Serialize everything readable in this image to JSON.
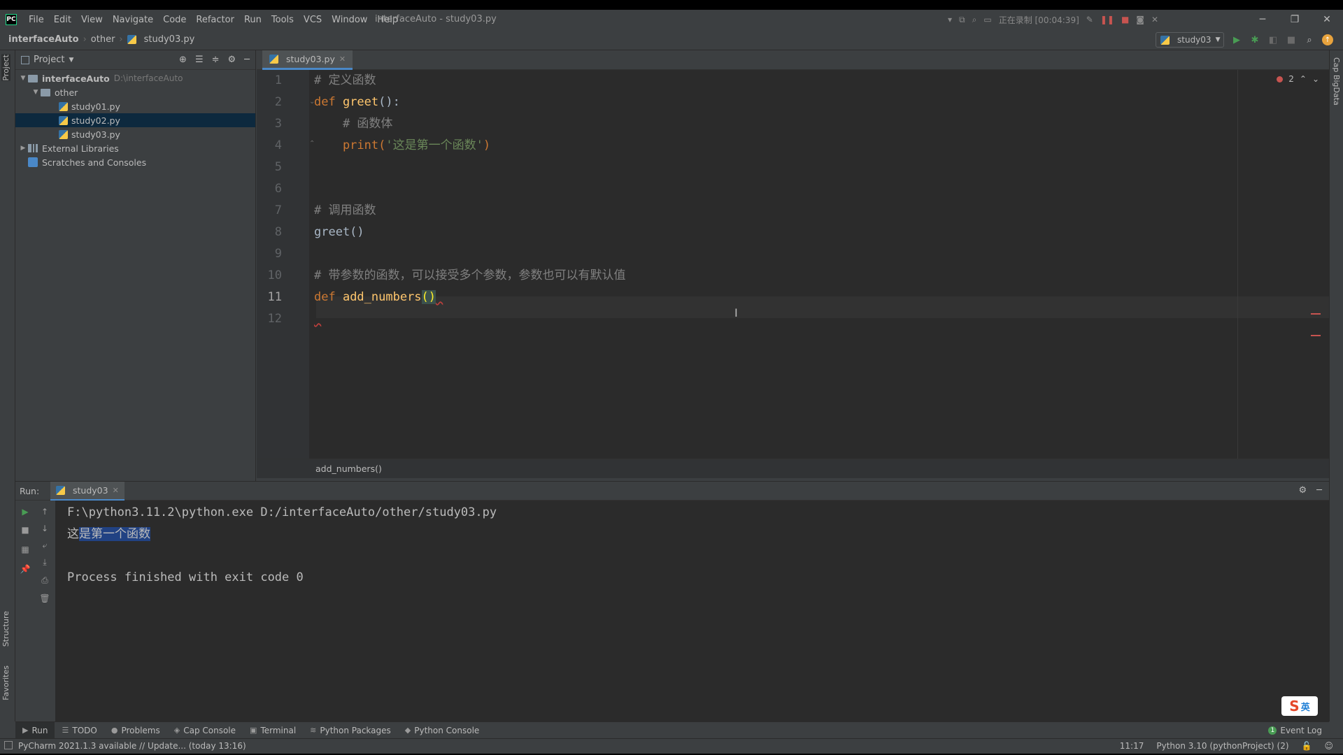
{
  "window": {
    "title": "interfaceAuto - study03.py",
    "recording_label": "正在录制 [00:04:39]"
  },
  "menu": [
    "File",
    "Edit",
    "View",
    "Navigate",
    "Code",
    "Refactor",
    "Run",
    "Tools",
    "VCS",
    "Window",
    "Help"
  ],
  "navbar": {
    "breadcrumbs": [
      "interfaceAuto",
      "other",
      "study03.py"
    ],
    "run_config": "study03"
  },
  "left_stripe": {
    "project": "Project",
    "structure": "Structure",
    "favorites": "Favorites"
  },
  "right_stripe": {
    "label": "Cap BigData"
  },
  "project_panel": {
    "title": "Project",
    "root": {
      "name": "interfaceAuto",
      "path": "D:\\interfaceAuto"
    },
    "folder": "other",
    "files": [
      "study01.py",
      "study02.py",
      "study03.py"
    ],
    "selected_file": "study02.py",
    "external_libraries": "External Libraries",
    "scratches": "Scratches and Consoles"
  },
  "editor": {
    "tab": "study03.py",
    "problems_count": "2",
    "line_numbers": [
      "1",
      "2",
      "3",
      "4",
      "5",
      "6",
      "7",
      "8",
      "9",
      "10",
      "11",
      "12"
    ],
    "current_line": "11",
    "lines": {
      "l1": "# 定义函数",
      "l2_kw": "def ",
      "l2_fn": "greet",
      "l2_rest": "():",
      "l3": "    # 函数体",
      "l4_fn": "    print(",
      "l4_str": "'这是第一个函数'",
      "l4_end": ")",
      "l7": "# 调用函数",
      "l8": "greet()",
      "l10": "# 带参数的函数，可以接受多个参数，参数也可以有默认值",
      "l11_kw": "def ",
      "l11_fn": "add_numbers",
      "l11_paren": "()"
    },
    "breadcrumb": "add_numbers()"
  },
  "run_panel": {
    "label": "Run:",
    "tab": "study03",
    "output": {
      "cmd": "F:\\python3.11.2\\python.exe D:/interfaceAuto/other/study03.py",
      "out_first": "这",
      "out_selected": "是第一个函数",
      "exit": "Process finished with exit code 0"
    }
  },
  "bottom_tabs": [
    "Run",
    "TODO",
    "Problems",
    "Cap Console",
    "Terminal",
    "Python Packages",
    "Python Console"
  ],
  "event_log": "Event Log",
  "event_log_count": "1",
  "ime": {
    "logo": "S",
    "lang": "英"
  },
  "status": {
    "message": "PyCharm 2021.1.3 available // Update... (today 13:16)",
    "position": "11:17",
    "interpreter": "Python 3.10 (pythonProject) (2)"
  }
}
